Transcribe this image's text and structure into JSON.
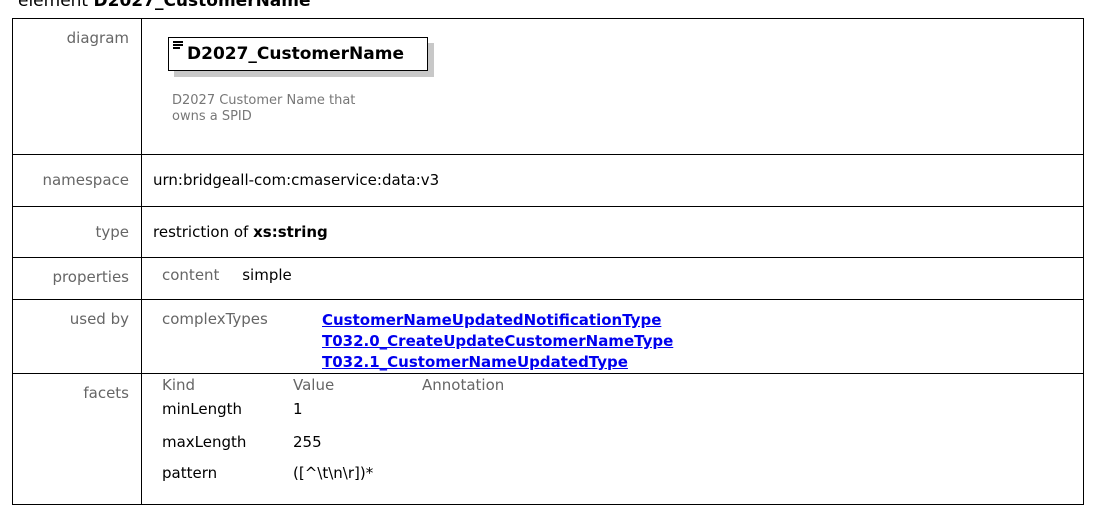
{
  "heading": {
    "prefix": "element",
    "name": "D2027_CustomerName"
  },
  "rows": {
    "diagram": {
      "label": "diagram",
      "box_name": "D2027_CustomerName",
      "doc": "D2027 Customer Name that owns a SPID"
    },
    "namespace": {
      "label": "namespace",
      "value": "urn:bridgeall-com:cmaservice:data:v3"
    },
    "type": {
      "label": "type",
      "prefix": "restriction of",
      "base": "xs:string"
    },
    "properties": {
      "label": "properties",
      "key": "content",
      "value": "simple"
    },
    "used_by": {
      "label": "used by",
      "category": "complexTypes",
      "links": [
        "CustomerNameUpdatedNotificationType",
        "T032.0_CreateUpdateCustomerNameType",
        "T032.1_CustomerNameUpdatedType"
      ]
    },
    "facets": {
      "label": "facets",
      "headers": [
        "Kind",
        "Value",
        "Annotation"
      ],
      "items": [
        {
          "kind": "minLength",
          "value": "1"
        },
        {
          "kind": "maxLength",
          "value": "255"
        },
        {
          "kind": "pattern",
          "value": "([^\\t\\n\\r])*"
        }
      ]
    }
  }
}
